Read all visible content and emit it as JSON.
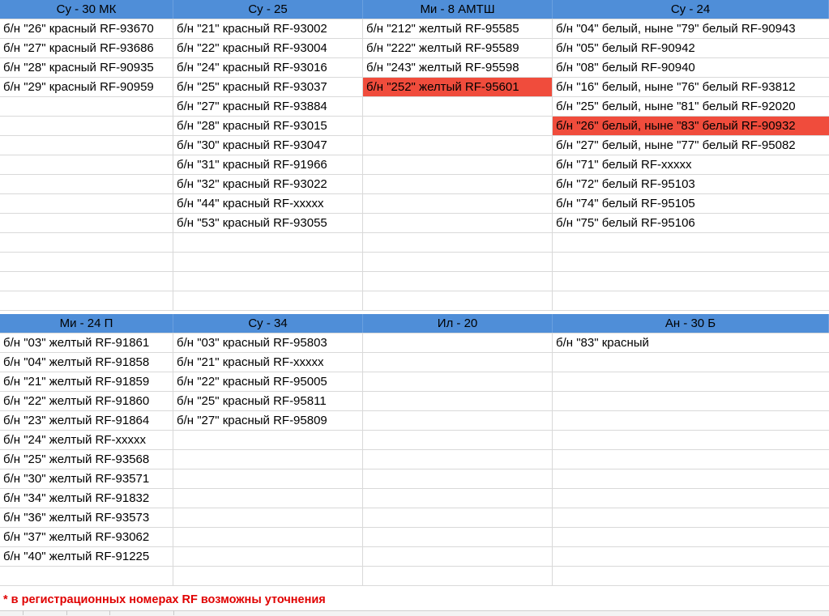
{
  "colors": {
    "header_fill": "#4f8ed8",
    "highlight_fill": "#f04c3c",
    "note_text": "#e00000",
    "gridline": "#d9d9d9"
  },
  "blocks": [
    {
      "headers": [
        "Су - 30 МК",
        "Су - 25",
        "Ми - 8 АМТШ",
        "Су - 24"
      ],
      "rows": 15,
      "columns": [
        [
          "б/н \"26\" красный  RF-93670",
          "б/н \"27\" красный  RF-93686",
          "б/н \"28\" красный  RF-90935",
          "б/н \"29\" красный  RF-90959"
        ],
        [
          "б/н \"21\" красный  RF-93002",
          "б/н \"22\" красный  RF-93004",
          "б/н \"24\" красный  RF-93016",
          "б/н \"25\" красный  RF-93037",
          "б/н \"27\" красный  RF-93884",
          "б/н \"28\" красный  RF-93015",
          "б/н \"30\" красный  RF-93047",
          "б/н \"31\" красный  RF-91966",
          "б/н \"32\" красный  RF-93022",
          "б/н \"44\" красный  RF-xxxxx",
          "б/н \"53\" красный  RF-93055"
        ],
        [
          "б/н \"212\" желтый  RF-95585",
          "б/н \"222\" желтый  RF-95589",
          "б/н \"243\" желтый  RF-95598",
          "б/н \"252\" желтый  RF-95601"
        ],
        [
          "б/н \"04\" белый, ныне \"79\" белый  RF-90943",
          "б/н \"05\" белый  RF-90942",
          "б/н \"08\" белый  RF-90940",
          "б/н \"16\" белый, ныне \"76\" белый  RF-93812",
          "б/н \"25\" белый, ныне \"81\" белый  RF-92020",
          "б/н \"26\" белый, ныне \"83\" белый  RF-90932",
          "б/н \"27\" белый, ныне \"77\" белый  RF-95082",
          "б/н \"71\" белый  RF-xxxxx",
          "б/н \"72\" белый  RF-95103",
          "б/н \"74\" белый  RF-95105",
          "б/н \"75\" белый  RF-95106"
        ]
      ],
      "highlighted": [
        [
          2,
          3
        ],
        [
          3,
          5
        ]
      ]
    },
    {
      "headers": [
        "Ми - 24 П",
        "Су - 34",
        "Ил - 20",
        "Ан - 30 Б"
      ],
      "rows": 13,
      "columns": [
        [
          "б/н \"03\" желтый  RF-91861",
          "б/н \"04\" желтый  RF-91858",
          "б/н \"21\" желтый  RF-91859",
          "б/н \"22\" желтый  RF-91860",
          "б/н \"23\" желтый  RF-91864",
          "б/н \"24\" желтый  RF-xxxxx",
          "б/н \"25\" желтый  RF-93568",
          "б/н \"30\" желтый  RF-93571",
          "б/н \"34\" желтый  RF-91832",
          "б/н \"36\" желтый  RF-93573",
          "б/н \"37\" желтый  RF-93062",
          "б/н \"40\" желтый  RF-91225"
        ],
        [
          "б/н \"03\" красный  RF-95803",
          "б/н \"21\" красный  RF-xxxxx",
          "б/н \"22\" красный  RF-95005",
          "б/н \"25\" красный  RF-95811",
          "б/н \"27\" красный  RF-95809"
        ],
        [],
        [
          "б/н \"83\" красный"
        ]
      ],
      "highlighted": []
    }
  ],
  "note": "* в регистрационных номерах RF возможны уточнения"
}
